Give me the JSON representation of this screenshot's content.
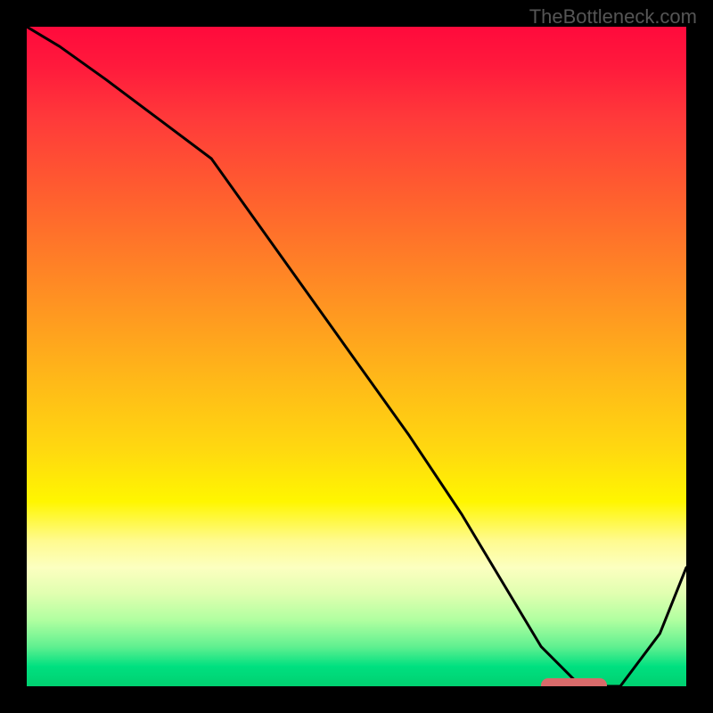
{
  "watermark": "TheBottleneck.com",
  "chart_data": {
    "type": "line",
    "title": "",
    "xlabel": "",
    "ylabel": "",
    "xlim": [
      0,
      100
    ],
    "ylim": [
      0,
      100
    ],
    "series": [
      {
        "name": "bottleneck-curve",
        "x": [
          0,
          5,
          12,
          20,
          28,
          38,
          48,
          58,
          66,
          72,
          78,
          84,
          90,
          96,
          100
        ],
        "y": [
          100,
          97,
          92,
          86,
          80,
          66,
          52,
          38,
          26,
          16,
          6,
          0,
          0,
          8,
          18
        ]
      }
    ],
    "optimal_marker": {
      "x_start": 78,
      "x_end": 88,
      "y": 0
    },
    "gradient_stops": [
      {
        "pos": 0,
        "color": "#ff0a3c"
      },
      {
        "pos": 50,
        "color": "#ffba18"
      },
      {
        "pos": 75,
        "color": "#fff600"
      },
      {
        "pos": 100,
        "color": "#00d070"
      }
    ]
  }
}
